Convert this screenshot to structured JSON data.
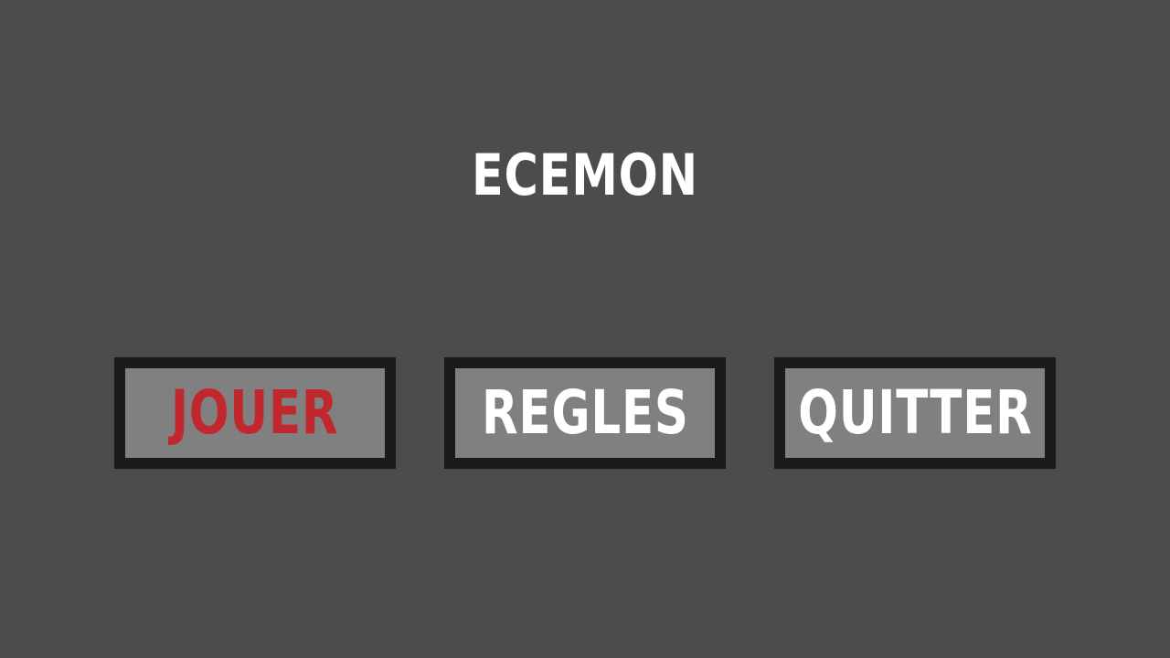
{
  "game": {
    "title": "ECEMON"
  },
  "menu": {
    "play_label": "JOUER",
    "rules_label": "REGLES",
    "quit_label": "QUITTER",
    "selected": "play"
  },
  "colors": {
    "background": "#4c4c4c",
    "button_border": "#1b1b1b",
    "button_fill": "#808080",
    "text": "#ffffff",
    "selected_text": "#c0282d"
  }
}
